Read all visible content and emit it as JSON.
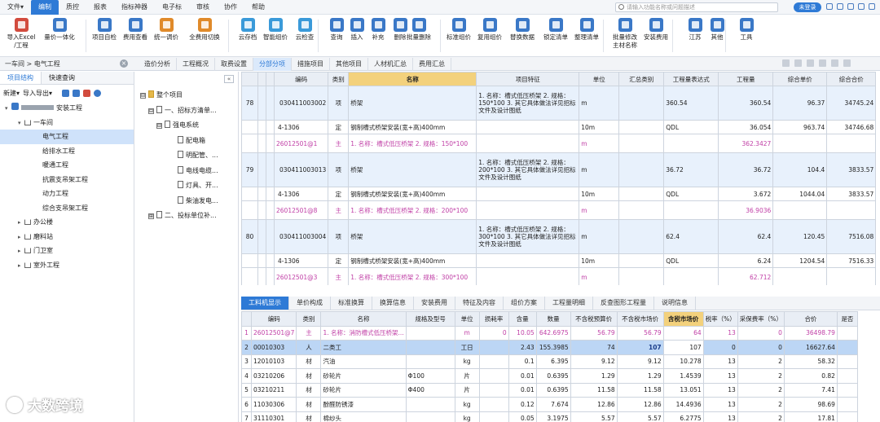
{
  "menu": [
    "文件▾",
    "编制",
    "质控",
    "报表",
    "指标神器",
    "电子标",
    "审核",
    "协作",
    "帮助"
  ],
  "search": {
    "placeholder": "请输入功能名称或问题描述"
  },
  "login_label": "未登录",
  "toolbar": [
    {
      "label": "导入Excel\n/工程",
      "color": "#d24b3e"
    },
    {
      "label": "量价一体化",
      "color": "#3a78c7"
    },
    {
      "label": "项目自检",
      "color": "#3a78c7"
    },
    {
      "label": "费用查看",
      "color": "#3a78c7"
    },
    {
      "label": "统一调价",
      "color": "#e08a2a"
    },
    {
      "label": "全费用切换",
      "color": "#e08a2a"
    },
    {
      "label": "云存档",
      "color": "#3a9ad9"
    },
    {
      "label": "智能组价",
      "color": "#3a9ad9"
    },
    {
      "label": "云检查",
      "color": "#3a9ad9"
    },
    {
      "label": "查询",
      "color": "#3a78c7"
    },
    {
      "label": "插入",
      "color": "#3a78c7"
    },
    {
      "label": "补充",
      "color": "#3a78c7"
    },
    {
      "label": "删除",
      "color": "#3a78c7"
    },
    {
      "label": "批量删除",
      "color": "#3a78c7"
    },
    {
      "label": "标准组价",
      "color": "#3a78c7"
    },
    {
      "label": "复用组价",
      "color": "#3a78c7"
    },
    {
      "label": "替换数据",
      "color": "#3a78c7"
    },
    {
      "label": "锁定清单",
      "color": "#3a78c7"
    },
    {
      "label": "整理清单",
      "color": "#3a78c7"
    },
    {
      "label": "批量修改\n主材名称",
      "color": "#3a78c7"
    },
    {
      "label": "安装费用",
      "color": "#3a78c7"
    },
    {
      "label": "江苏",
      "color": "#3a78c7"
    },
    {
      "label": "其他",
      "color": "#3a78c7"
    },
    {
      "label": "工具",
      "color": "#3a78c7"
    }
  ],
  "breadcrumb": "一车间 > 电气工程",
  "main_tabs": [
    "造价分析",
    "工程概况",
    "取费设置",
    "分部分项",
    "措施项目",
    "其他项目",
    "人材机汇总",
    "费用汇总"
  ],
  "left": {
    "tabs": [
      "项目结构",
      "快速查询"
    ],
    "tools": [
      "新建▾",
      "导入导出▾"
    ],
    "project": "安装工程",
    "items": [
      {
        "label": "一车间",
        "level": 1,
        "arrow": "▾"
      },
      {
        "label": "电气工程",
        "level": 2,
        "sel": true
      },
      {
        "label": "给排水工程",
        "level": 2
      },
      {
        "label": "暖通工程",
        "level": 2
      },
      {
        "label": "抗震支吊架工程",
        "level": 2
      },
      {
        "label": "动力工程",
        "level": 2
      },
      {
        "label": "综合支吊架工程",
        "level": 2
      },
      {
        "label": "办公楼",
        "level": 1,
        "arrow": "▸"
      },
      {
        "label": "磨料站",
        "level": 1,
        "arrow": "▸"
      },
      {
        "label": "门卫室",
        "level": 1,
        "arrow": "▸"
      },
      {
        "label": "室外工程",
        "level": 1,
        "arrow": "▸"
      }
    ]
  },
  "mid": {
    "items": [
      {
        "label": "整个项目",
        "level": 0,
        "box": "⊟"
      },
      {
        "label": "一、招标方清单...",
        "level": 1,
        "box": "⊟"
      },
      {
        "label": "强电系统",
        "level": 2,
        "box": "⊟"
      },
      {
        "label": "配电箱",
        "level": 3
      },
      {
        "label": "明配管、...",
        "level": 3
      },
      {
        "label": "电线电缆...",
        "level": 3
      },
      {
        "label": "灯具、开...",
        "level": 3
      },
      {
        "label": "柴油发电...",
        "level": 3
      },
      {
        "label": "二、投标单位补...",
        "level": 1,
        "box": "⊞"
      }
    ]
  },
  "grid": {
    "headers": [
      "",
      "",
      "",
      "编码",
      "类别",
      "名称",
      "项目特征",
      "单位",
      "汇总类别",
      "工程量表达式",
      "工程量",
      "综合单价",
      "综合合价"
    ],
    "rows": [
      {
        "type": "main",
        "no": "78",
        "code": "030411003002",
        "cat": "项",
        "name": "桥架",
        "feat": "1. 名称：槽式低压桥架\n2. 规格：150*100\n3. 其它具体做法详见招标文件及设计图纸",
        "unit": "m",
        "sum": "",
        "expr": "360.54",
        "qty": "360.54",
        "price": "96.37",
        "total": "34745.24"
      },
      {
        "type": "sub",
        "no": "",
        "code": "4-1306",
        "cat": "定",
        "name": "钢制槽式桥架安装(宽+高)400mm",
        "feat": "",
        "unit": "10m",
        "sum": "",
        "expr": "QDL",
        "qty": "36.054",
        "price": "963.74",
        "total": "34746.68"
      },
      {
        "type": "det",
        "no": "",
        "code": "26012501@1",
        "cat": "主",
        "name": "1. 名称：槽式低压桥架\n2. 规格：150*100",
        "feat": "",
        "unit": "m",
        "sum": "",
        "expr": "",
        "qty": "362.3427",
        "price": "",
        "total": ""
      },
      {
        "type": "main",
        "no": "79",
        "code": "030411003013",
        "cat": "项",
        "name": "桥架",
        "feat": "1. 名称：槽式低压桥架\n2. 规格：200*100\n3. 其它具体做法详见招标文件及设计图纸",
        "unit": "m",
        "sum": "",
        "expr": "36.72",
        "qty": "36.72",
        "price": "104.4",
        "total": "3833.57"
      },
      {
        "type": "sub",
        "no": "",
        "code": "4-1306",
        "cat": "定",
        "name": "钢制槽式桥架安装(宽+高)400mm",
        "feat": "",
        "unit": "10m",
        "sum": "",
        "expr": "QDL",
        "qty": "3.672",
        "price": "1044.04",
        "total": "3833.57"
      },
      {
        "type": "det",
        "no": "",
        "code": "26012501@8",
        "cat": "主",
        "name": "1. 名称：槽式低压桥架\n2. 规格：200*100",
        "feat": "",
        "unit": "m",
        "sum": "",
        "expr": "",
        "qty": "36.9036",
        "price": "",
        "total": ""
      },
      {
        "type": "main",
        "no": "80",
        "code": "030411003004",
        "cat": "项",
        "name": "桥架",
        "feat": "1. 名称：槽式低压桥架\n2. 规格：300*100\n3. 其它具体做法详见招标文件及设计图纸",
        "unit": "m",
        "sum": "",
        "expr": "62.4",
        "qty": "62.4",
        "price": "120.45",
        "total": "7516.08"
      },
      {
        "type": "sub",
        "no": "",
        "code": "4-1306",
        "cat": "定",
        "name": "钢制槽式桥架安装(宽+高)400mm",
        "feat": "",
        "unit": "10m",
        "sum": "",
        "expr": "QDL",
        "qty": "6.24",
        "price": "1204.54",
        "total": "7516.33"
      },
      {
        "type": "det",
        "no": "",
        "code": "26012501@3",
        "cat": "主",
        "name": "1. 名称：槽式低压桥架\n2. 规格：300*100",
        "feat": "",
        "unit": "m",
        "sum": "",
        "expr": "",
        "qty": "62.712",
        "price": "",
        "total": ""
      }
    ]
  },
  "bottom_tabs": [
    "工料机显示",
    "单价构成",
    "标准换算",
    "换算信息",
    "安装费用",
    "特征及内容",
    "组价方案",
    "工程量明细",
    "反查图形工程量",
    "说明信息"
  ],
  "bgrid": {
    "headers": [
      "",
      "编码",
      "类别",
      "名称",
      "规格及型号",
      "单位",
      "损耗率",
      "含量",
      "数量",
      "不含税预算价",
      "不含税市场价",
      "含税市场价",
      "税率（%）",
      "采保费率（%）",
      "合价",
      "是否"
    ],
    "rows": [
      {
        "no": "1",
        "code": "26012501@7",
        "cat": "主",
        "name": "1. 名称：消防槽式低压桥架...",
        "spec": "",
        "unit": "m",
        "loss": "0",
        "cont": "10.05",
        "qty": "642.6975",
        "p1": "56.79",
        "p2": "56.79",
        "p3": "64",
        "tax": "13",
        "fee": "0",
        "total": "36498.79",
        "flag": "",
        "cls": "pink"
      },
      {
        "no": "2",
        "code": "00010303",
        "cat": "人",
        "name": "二类工",
        "spec": "",
        "unit": "工日",
        "loss": "",
        "cont": "2.43",
        "qty": "155.3985",
        "p1": "74",
        "p2": "107",
        "p3": "107",
        "tax": "0",
        "fee": "0",
        "total": "16627.64",
        "flag": "",
        "cls": "sel"
      },
      {
        "no": "3",
        "code": "12010103",
        "cat": "材",
        "name": "汽油",
        "spec": "",
        "unit": "kg",
        "loss": "",
        "cont": "0.1",
        "qty": "6.395",
        "p1": "9.12",
        "p2": "9.12",
        "p3": "10.278",
        "tax": "13",
        "fee": "2",
        "total": "58.32",
        "flag": "",
        "cls": ""
      },
      {
        "no": "4",
        "code": "03210206",
        "cat": "材",
        "name": "砂轮片",
        "spec": "Φ100",
        "unit": "片",
        "loss": "",
        "cont": "0.01",
        "qty": "0.6395",
        "p1": "1.29",
        "p2": "1.29",
        "p3": "1.4539",
        "tax": "13",
        "fee": "2",
        "total": "0.82",
        "flag": "",
        "cls": ""
      },
      {
        "no": "5",
        "code": "03210211",
        "cat": "材",
        "name": "砂轮片",
        "spec": "Φ400",
        "unit": "片",
        "loss": "",
        "cont": "0.01",
        "qty": "0.6395",
        "p1": "11.58",
        "p2": "11.58",
        "p3": "13.051",
        "tax": "13",
        "fee": "2",
        "total": "7.41",
        "flag": "",
        "cls": ""
      },
      {
        "no": "6",
        "code": "11030306",
        "cat": "材",
        "name": "酚醛防锈漆",
        "spec": "",
        "unit": "kg",
        "loss": "",
        "cont": "0.12",
        "qty": "7.674",
        "p1": "12.86",
        "p2": "12.86",
        "p3": "14.4936",
        "tax": "13",
        "fee": "2",
        "total": "98.69",
        "flag": "",
        "cls": ""
      },
      {
        "no": "7",
        "code": "31110301",
        "cat": "材",
        "name": "棉纱头",
        "spec": "",
        "unit": "kg",
        "loss": "",
        "cont": "0.05",
        "qty": "3.1975",
        "p1": "5.57",
        "p2": "5.57",
        "p3": "6.2775",
        "tax": "13",
        "fee": "2",
        "total": "17.81",
        "flag": "",
        "cls": ""
      }
    ]
  },
  "watermark": "大数跨境"
}
